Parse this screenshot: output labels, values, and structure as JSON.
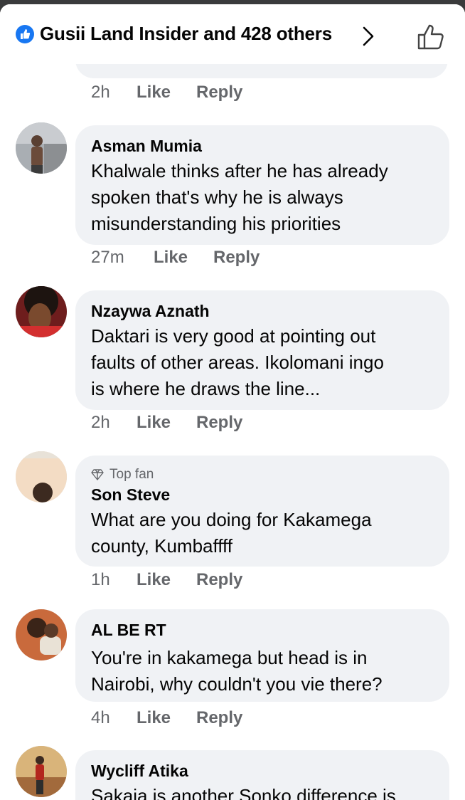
{
  "header": {
    "title": "Gusii Land Insider and 428 others",
    "reaction_icon": "like-badge-icon",
    "chevron_icon": "chevron-right-icon",
    "like_icon": "thumbs-up-outline-icon",
    "accent": "#1877f2"
  },
  "previous_comment_actions": {
    "time": "2h",
    "like": "Like",
    "reply": "Reply"
  },
  "comments": [
    {
      "author": "Asman Mumia",
      "lines": [
        "Khalwale thinks after he has already",
        "spoken that's why he is always",
        "misunderstanding his priorities"
      ],
      "time": "27m",
      "like": "Like",
      "reply": "Reply"
    },
    {
      "author": "Nzaywa Aznath",
      "lines": [
        "Daktari is very good at pointing out",
        "faults of other areas.  Ikolomani ingo",
        "is where he draws the line..."
      ],
      "time": "2h",
      "like": "Like",
      "reply": "Reply"
    },
    {
      "badge": "Top fan",
      "author": "Son Steve",
      "lines": [
        "What are you doing for Kakamega",
        "county, Kumbaffff"
      ],
      "time": "1h",
      "like": "Like",
      "reply": "Reply"
    },
    {
      "author": "AL BE RT",
      "lines": [
        "You're in kakamega but head is in",
        "Nairobi, why couldn't you vie there?"
      ],
      "time": "4h",
      "like": "Like",
      "reply": "Reply"
    },
    {
      "author": "Wycliff Atika",
      "lines": [
        "Sakaja is another Sonko difference is"
      ]
    }
  ]
}
